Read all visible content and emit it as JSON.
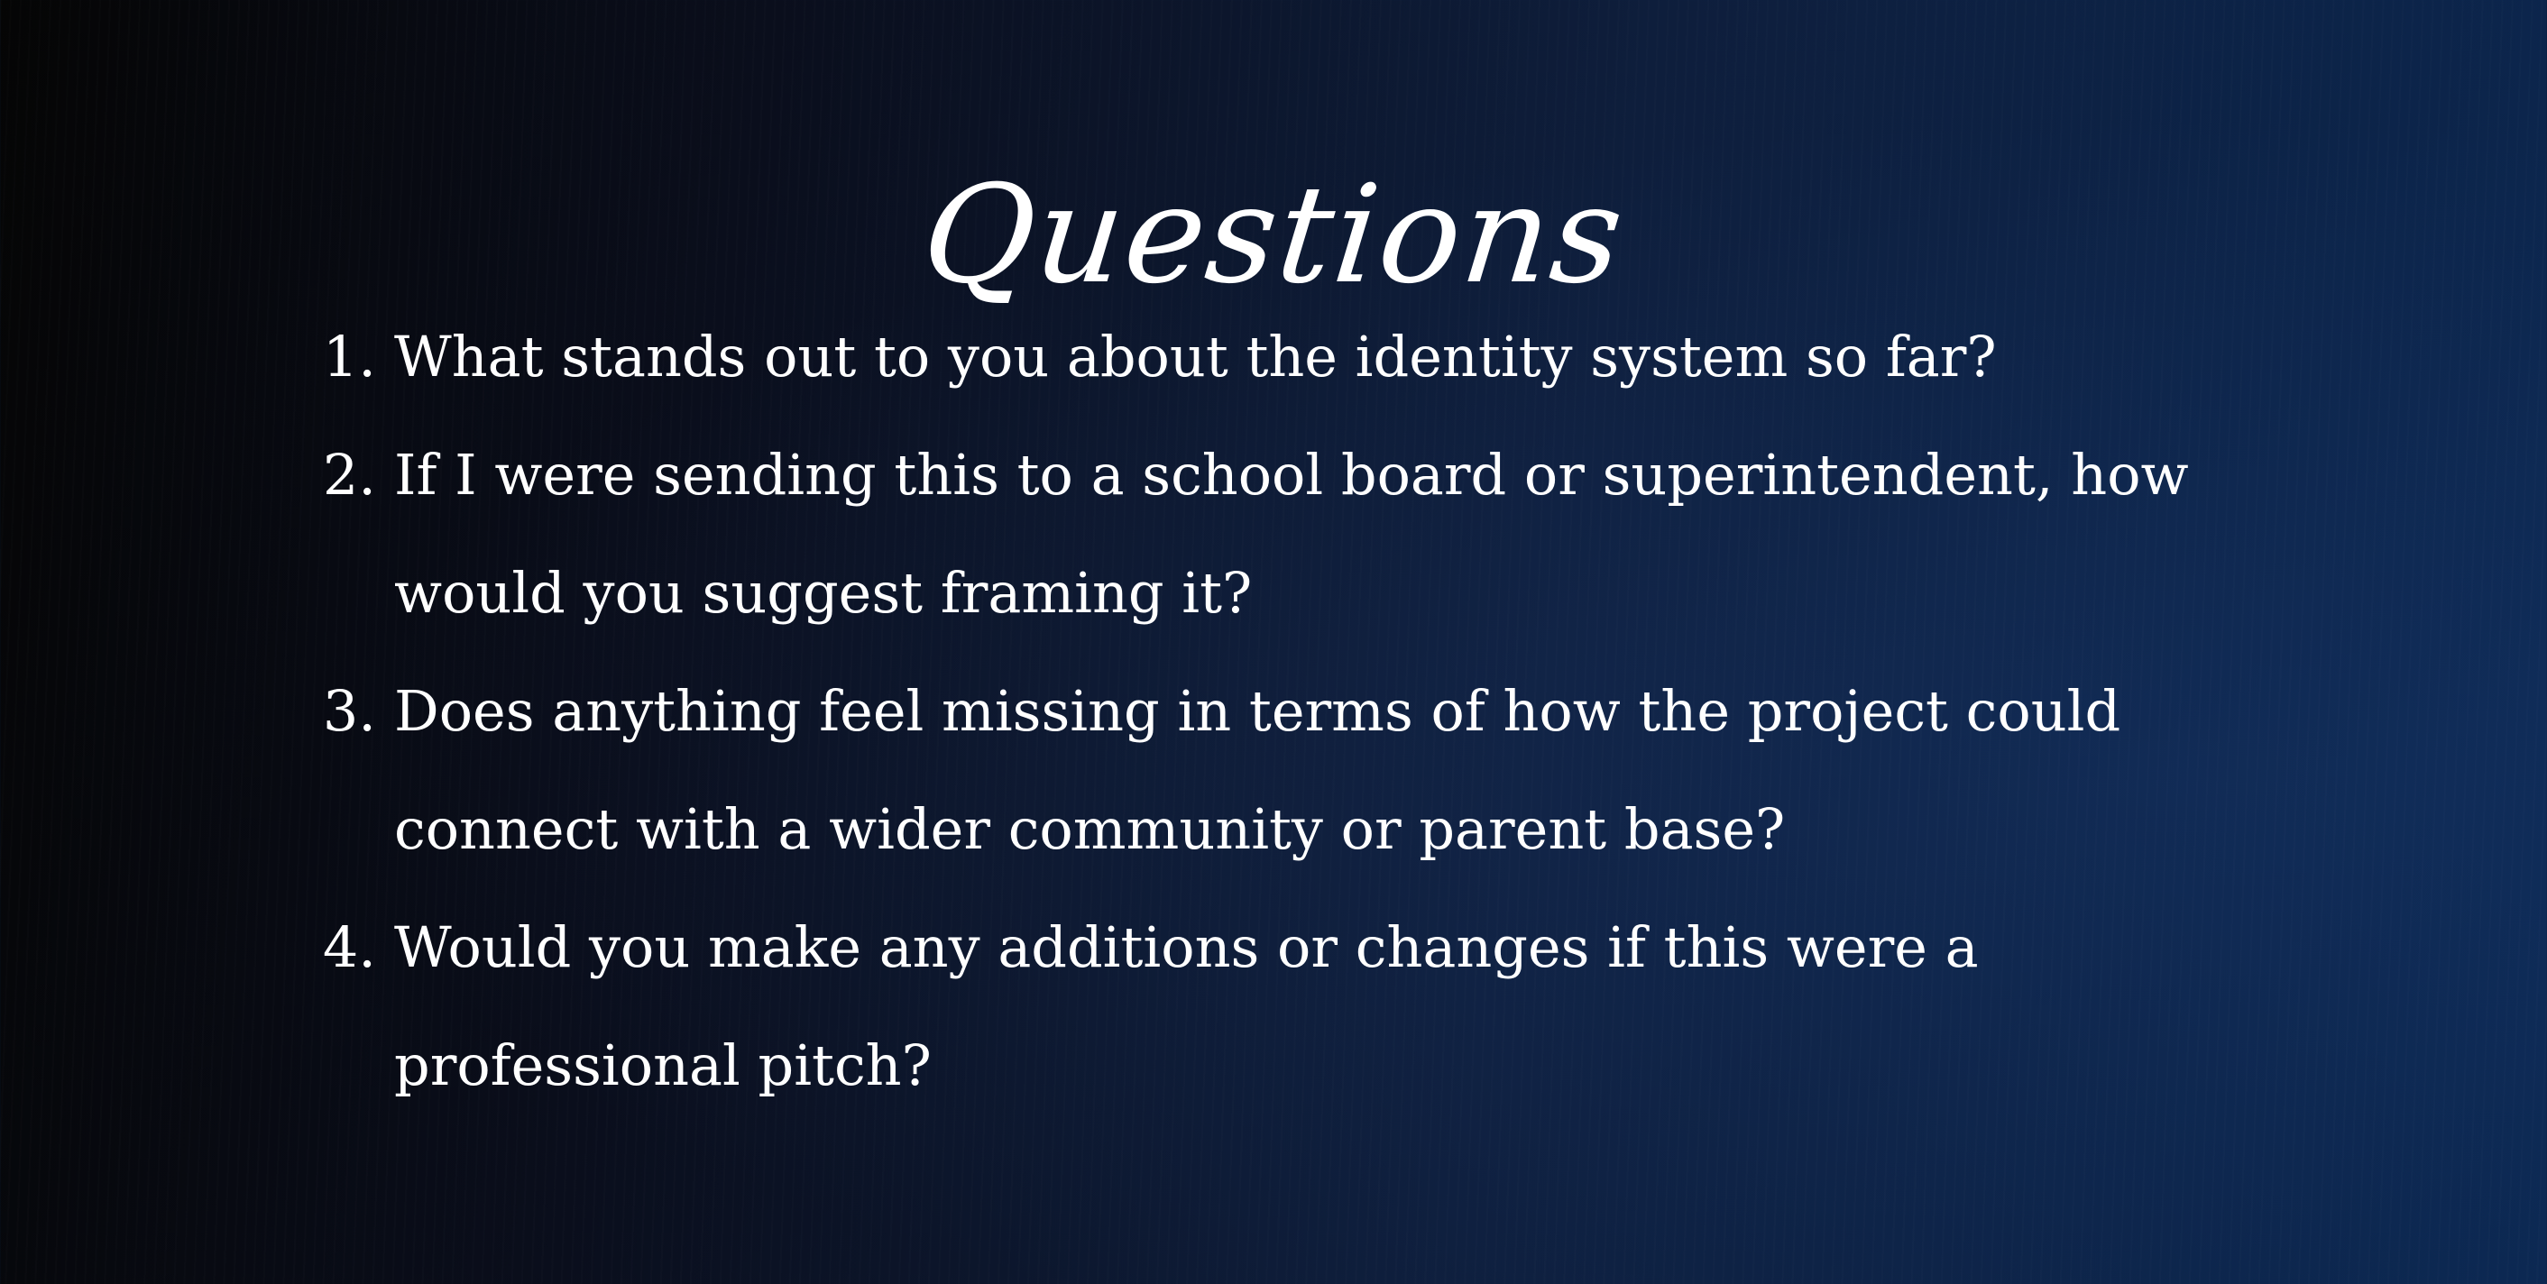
{
  "slide": {
    "title": "Questions",
    "questions": [
      {
        "number": "1.",
        "text": "What stands out to you about the identity system so far?"
      },
      {
        "number": "2.",
        "text": "If I were sending this to a school board or superintendent, how would you suggest framing it?"
      },
      {
        "number": "3.",
        "text": "Does anything feel missing in terms of how the project could connect with a wider community or parent base?"
      },
      {
        "number": "4.",
        "text": "Would you make any additions or changes if this were a professional pitch?"
      }
    ]
  },
  "colors": {
    "background_left": "#050505",
    "background_right": "#0b2750",
    "text": "#ffffff"
  }
}
